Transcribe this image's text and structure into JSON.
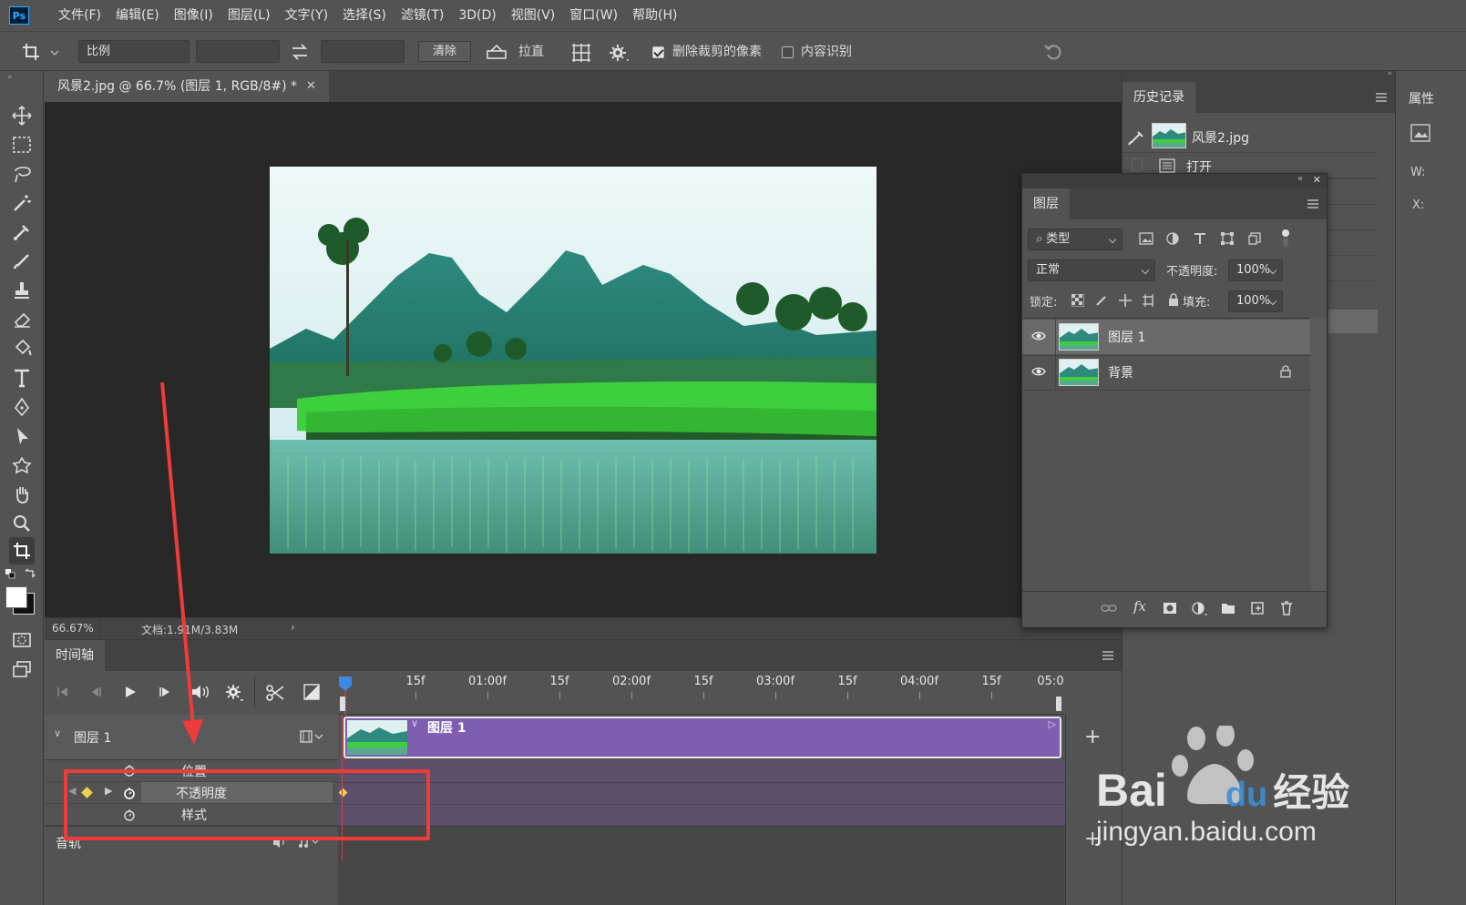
{
  "menubar": {
    "logo": "Ps",
    "items": [
      "文件(F)",
      "编辑(E)",
      "图像(I)",
      "图层(L)",
      "文字(Y)",
      "选择(S)",
      "滤镜(T)",
      "3D(D)",
      "视图(V)",
      "窗口(W)",
      "帮助(H)"
    ]
  },
  "options": {
    "ratio_select": "比例",
    "clear_button": "清除",
    "straighten_label": "拉直",
    "delete_cropped_label": "删除裁剪的像素",
    "delete_cropped_checked": true,
    "content_aware_label": "内容识别",
    "content_aware_checked": false
  },
  "document": {
    "tab_title": "风景2.jpg @ 66.7% (图层 1, RGB/8#) *",
    "zoom": "66.67%",
    "doc_info": "文档:1.91M/3.83M"
  },
  "timeline": {
    "tab": "时间轴",
    "ruler_labels": [
      "15f",
      "01:00f",
      "15f",
      "02:00f",
      "15f",
      "03:00f",
      "15f",
      "04:00f",
      "15f",
      "05:0"
    ],
    "layer_track": "图层 1",
    "clip_label": "图层 1",
    "props": [
      "位置",
      "不透明度",
      "样式"
    ],
    "audio_label": "音轨"
  },
  "history": {
    "tab": "历史记录",
    "snapshot": "风景2.jpg",
    "steps": [
      "打开"
    ]
  },
  "properties": {
    "tab": "属性",
    "w_label": "W:",
    "x_label": "X:"
  },
  "layers": {
    "tab": "图层",
    "filter_kind": "类型",
    "blend_mode": "正常",
    "opacity_label": "不透明度:",
    "opacity_value": "100%",
    "lock_label": "锁定:",
    "fill_label": "填充:",
    "fill_value": "100%",
    "items": [
      {
        "name": "图层 1",
        "selected": true,
        "locked": false
      },
      {
        "name": "背景",
        "selected": false,
        "locked": true
      }
    ],
    "fx_label": "fx"
  },
  "watermark": {
    "brand": "Bai",
    "brand_du": "du",
    "brand_cn": "经验",
    "url": "jingyan.baidu.com"
  }
}
